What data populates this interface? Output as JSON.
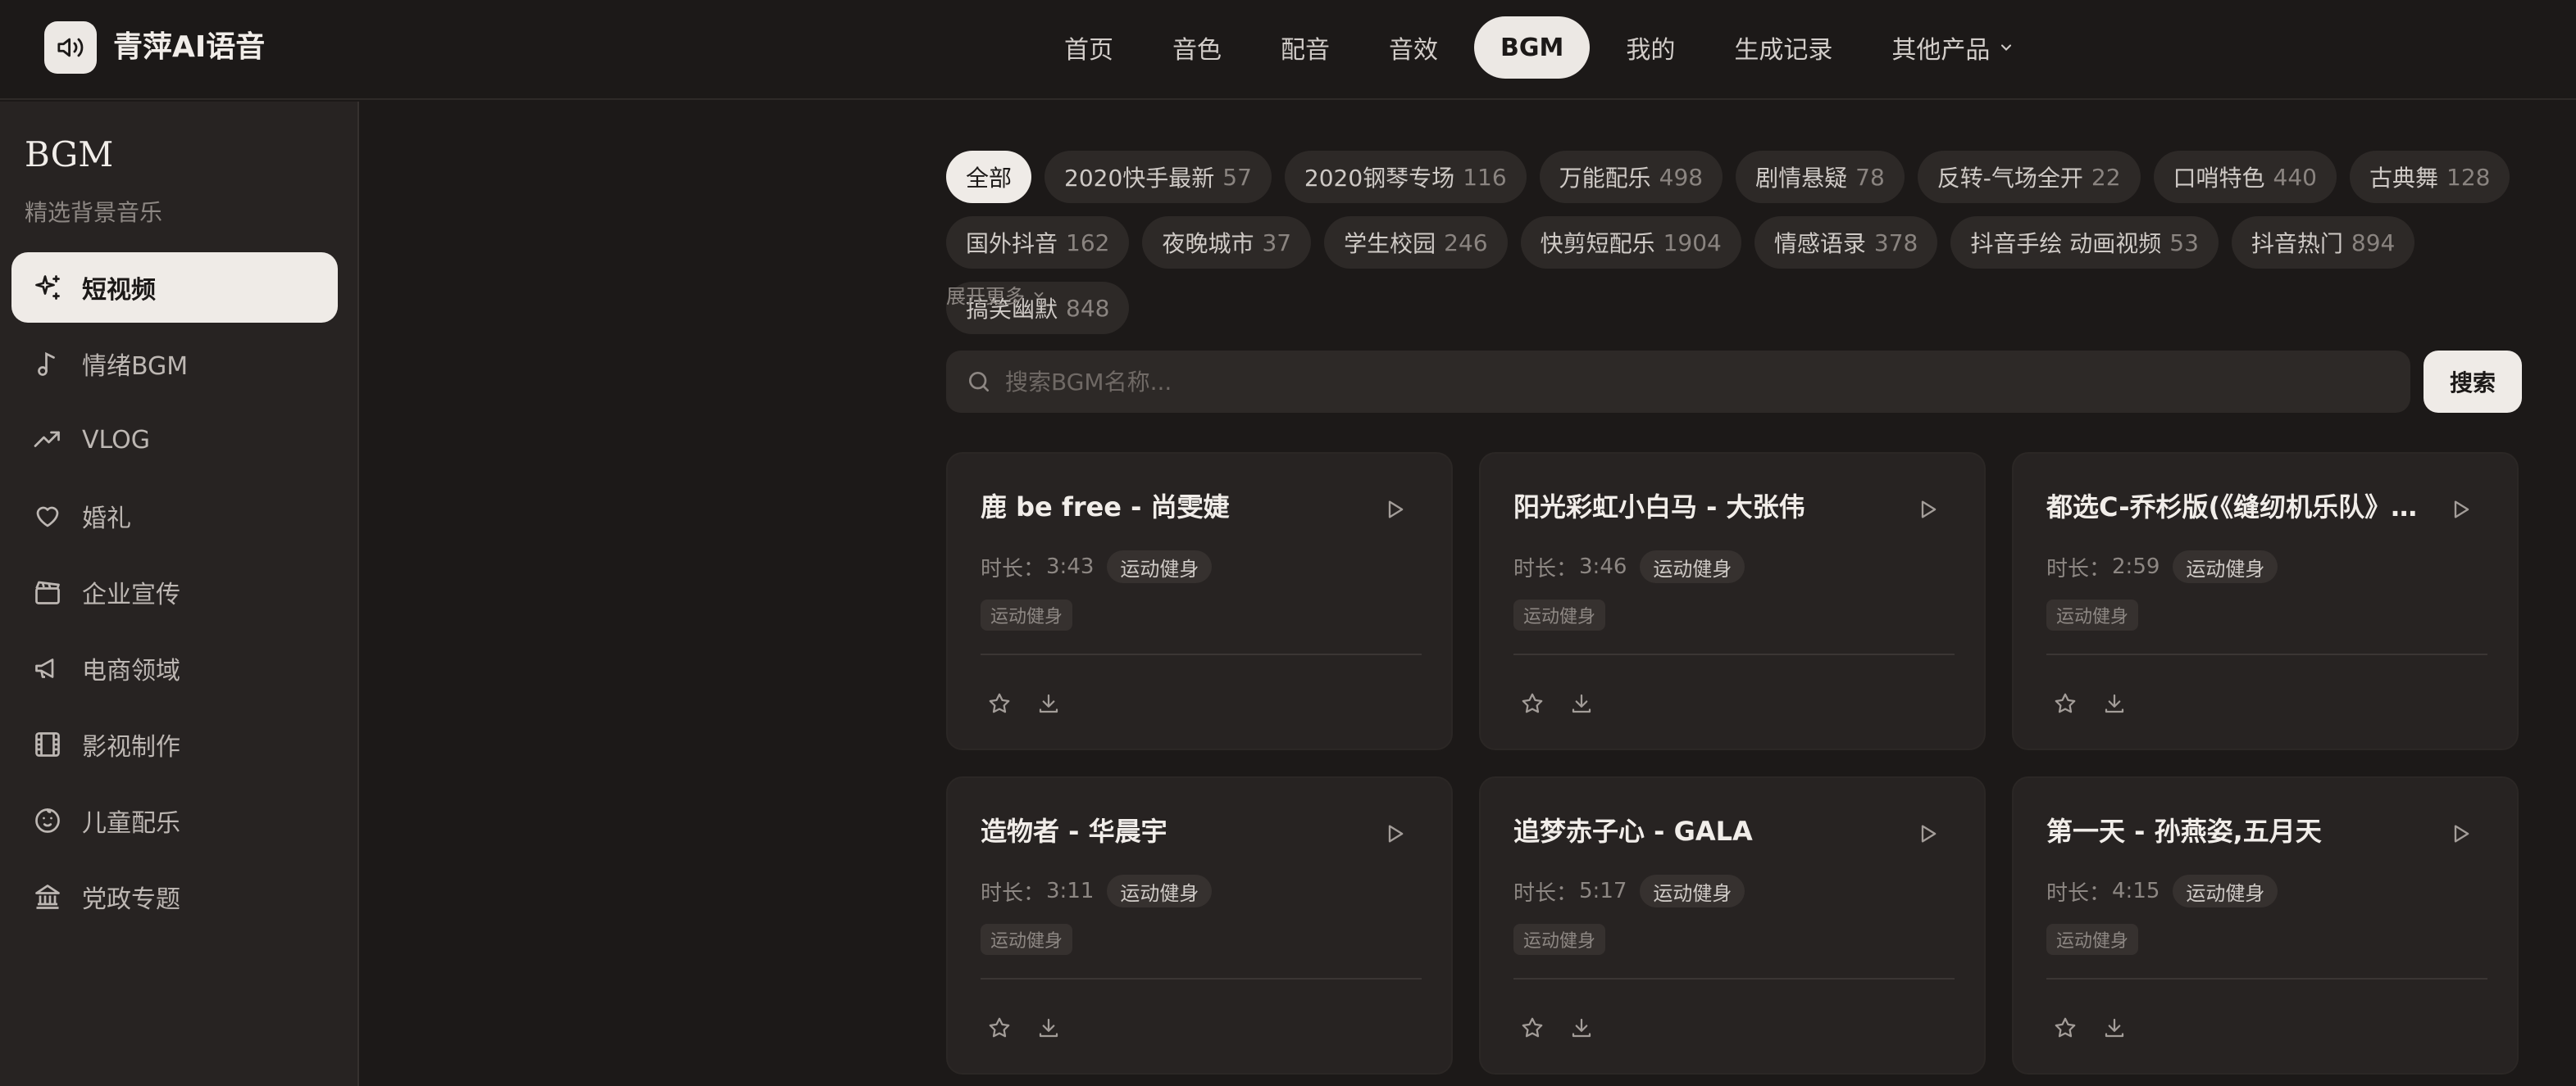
{
  "app": {
    "title": "青萍AI语音",
    "logo_icon": "speaker-icon"
  },
  "nav": {
    "items": [
      {
        "label": "首页"
      },
      {
        "label": "音色"
      },
      {
        "label": "配音"
      },
      {
        "label": "音效"
      },
      {
        "label": "BGM",
        "active": true
      },
      {
        "label": "我的"
      },
      {
        "label": "生成记录"
      },
      {
        "label": "其他产品",
        "dropdown": true
      }
    ]
  },
  "sidebar": {
    "title": "BGM",
    "subtitle": "精选背景音乐",
    "items": [
      {
        "label": "短视频",
        "icon": "sparkle-icon",
        "active": true
      },
      {
        "label": "情绪BGM",
        "icon": "music-note-icon"
      },
      {
        "label": "VLOG",
        "icon": "trending-up-icon"
      },
      {
        "label": "婚礼",
        "icon": "heart-icon"
      },
      {
        "label": "企业宣传",
        "icon": "clapperboard-icon"
      },
      {
        "label": "电商领域",
        "icon": "megaphone-icon"
      },
      {
        "label": "影视制作",
        "icon": "film-icon"
      },
      {
        "label": "儿童配乐",
        "icon": "baby-icon"
      },
      {
        "label": "党政专题",
        "icon": "landmark-icon"
      }
    ]
  },
  "categories": [
    {
      "label": "全部",
      "count": "",
      "active": true
    },
    {
      "label": "2020快手最新",
      "count": "57"
    },
    {
      "label": "2020钢琴专场",
      "count": "116"
    },
    {
      "label": "万能配乐",
      "count": "498"
    },
    {
      "label": "剧情悬疑",
      "count": "78"
    },
    {
      "label": "反转-气场全开",
      "count": "22"
    },
    {
      "label": "口哨特色",
      "count": "440"
    },
    {
      "label": "古典舞",
      "count": "128"
    },
    {
      "label": "国外抖音",
      "count": "162"
    },
    {
      "label": "夜晚城市",
      "count": "37"
    },
    {
      "label": "学生校园",
      "count": "246"
    },
    {
      "label": "快剪短配乐",
      "count": "1904"
    },
    {
      "label": "情感语录",
      "count": "378"
    },
    {
      "label": "抖音手绘 动画视频",
      "count": "53"
    },
    {
      "label": "抖音热门",
      "count": "894"
    },
    {
      "label": "搞笑幽默",
      "count": "848"
    }
  ],
  "expand_label": "展开更多",
  "search": {
    "placeholder": "搜索BGM名称...",
    "value": "",
    "button_label": "搜索"
  },
  "duration_label": "时长：",
  "tracks": [
    {
      "title": "鹿 be free - 尚雯婕",
      "duration": "3:43",
      "badge": "运动健身",
      "tag": "运动健身"
    },
    {
      "title": "阳光彩虹小白马 - 大张伟",
      "duration": "3:46",
      "badge": "运动健身",
      "tag": "运动健身"
    },
    {
      "title": "都选C-乔杉版(《缝纫机乐队》电影插曲)",
      "duration": "2:59",
      "badge": "运动健身",
      "tag": "运动健身"
    },
    {
      "title": "造物者 - 华晨宇",
      "duration": "3:11",
      "badge": "运动健身",
      "tag": "运动健身"
    },
    {
      "title": "追梦赤子心 - GALA",
      "duration": "5:17",
      "badge": "运动健身",
      "tag": "运动健身"
    },
    {
      "title": "第一天 - 孙燕姿,五月天",
      "duration": "4:15",
      "badge": "运动健身",
      "tag": "运动健身"
    }
  ]
}
